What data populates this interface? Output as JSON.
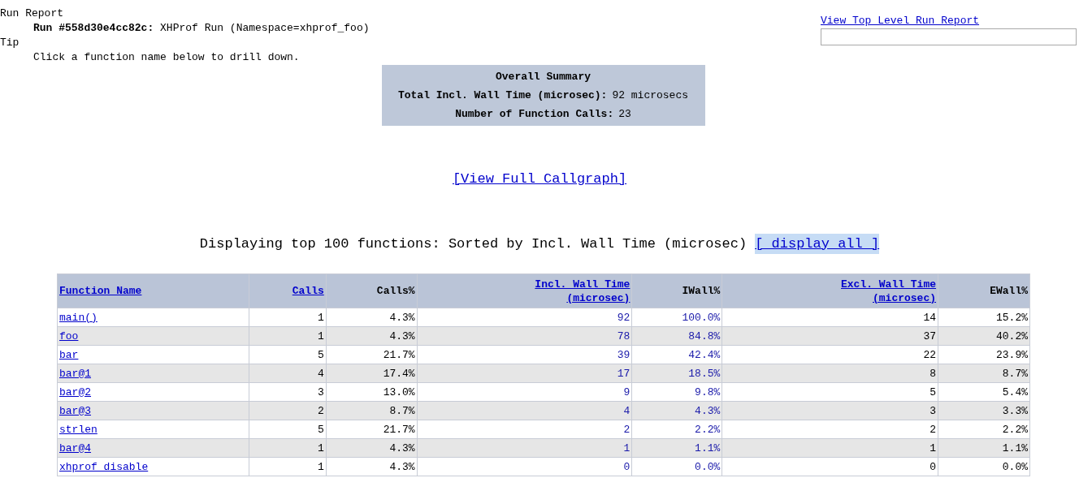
{
  "header": {
    "title": "Run Report",
    "run_label": "Run #558d30e4cc82c:",
    "run_text": "XHProf Run (Namespace=xhprof_foo)",
    "tip_title": "Tip",
    "tip_text": "Click a function name below to drill down."
  },
  "top_link": "View Top Level Run Report",
  "summary": {
    "title": "Overall Summary",
    "rows": [
      {
        "label": "Total Incl. Wall Time (microsec):",
        "value": "92 microsecs"
      },
      {
        "label": "Number of Function Calls:",
        "value": "23"
      }
    ]
  },
  "callgraph_link": "[View Full Callgraph]",
  "display_text": "Displaying top 100 functions: Sorted by Incl. Wall Time (microsec)",
  "display_all_link": "[ display all ]",
  "table": {
    "columns": [
      {
        "label": "Function Name",
        "kind": "link",
        "cell_link": true
      },
      {
        "label": "Calls",
        "kind": "link",
        "cell_link": false,
        "cell_blue": false
      },
      {
        "label": "Calls%",
        "kind": "plain",
        "cell_link": false,
        "cell_blue": false
      },
      {
        "label": "Incl. Wall Time (microsec)",
        "kind": "link",
        "cell_link": false,
        "cell_blue": true
      },
      {
        "label": "IWall%",
        "kind": "plain",
        "cell_link": false,
        "cell_blue": true
      },
      {
        "label": "Excl. Wall Time (microsec)",
        "kind": "link",
        "cell_link": false,
        "cell_blue": false
      },
      {
        "label": "EWall%",
        "kind": "plain",
        "cell_link": false,
        "cell_blue": false
      }
    ],
    "rows": [
      [
        "main()",
        "1",
        "4.3%",
        "92",
        "100.0%",
        "14",
        "15.2%"
      ],
      [
        "foo",
        "1",
        "4.3%",
        "78",
        "84.8%",
        "37",
        "40.2%"
      ],
      [
        "bar",
        "5",
        "21.7%",
        "39",
        "42.4%",
        "22",
        "23.9%"
      ],
      [
        "bar@1",
        "4",
        "17.4%",
        "17",
        "18.5%",
        "8",
        "8.7%"
      ],
      [
        "bar@2",
        "3",
        "13.0%",
        "9",
        "9.8%",
        "5",
        "5.4%"
      ],
      [
        "bar@3",
        "2",
        "8.7%",
        "4",
        "4.3%",
        "3",
        "3.3%"
      ],
      [
        "strlen",
        "5",
        "21.7%",
        "2",
        "2.2%",
        "2",
        "2.2%"
      ],
      [
        "bar@4",
        "1",
        "4.3%",
        "1",
        "1.1%",
        "1",
        "1.1%"
      ],
      [
        "xhprof_disable",
        "1",
        "4.3%",
        "0",
        "0.0%",
        "0",
        "0.0%"
      ]
    ]
  }
}
